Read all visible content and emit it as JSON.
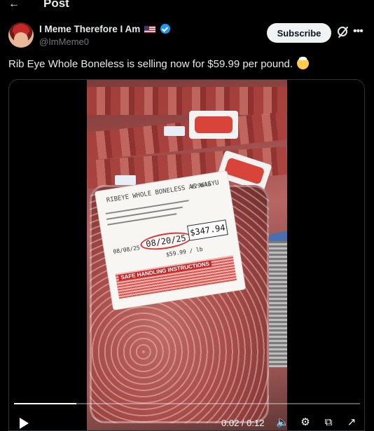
{
  "header": {
    "back_icon": "arrow-left-icon",
    "title": "Post"
  },
  "author": {
    "display_name": "I Meme Therefore I Am",
    "handle": "@ImMeme0",
    "flag_icon": "us-flag-icon",
    "verified_icon": "verified-badge-icon",
    "verified_color": "#1d9bf0"
  },
  "actions": {
    "subscribe_label": "Subscribe",
    "grok_icon": "grok-icon",
    "more_icon": "more-horizontal-icon"
  },
  "post": {
    "text": "Rib Eye Whole Boneless is selling now for $59.99 per pound.",
    "emoji": "exploding-head-emoji"
  },
  "video": {
    "label": {
      "product": "RIBEYE WHOLE BONELESS AS WAGYU",
      "plu": "#29643",
      "sell_by": "08/20/25",
      "pack_date": "08/08/25",
      "unit_price": "$59.99 / lb",
      "total_price": "$347.94",
      "safe_handling": "SAFE HANDLING INSTRUCTIONS"
    },
    "progress_fraction": 0.18,
    "current_time": "0:02",
    "separator": "/",
    "duration": "0:12",
    "time_text": "0:02 / 0:12",
    "controls": [
      "play-icon",
      "volume-icon",
      "settings-gear-icon",
      "picture-in-picture-icon",
      "fullscreen-icon"
    ]
  },
  "colors": {
    "background": "#000000",
    "text_primary": "#e7e9ea",
    "text_secondary": "#71767b",
    "subscribe_bg": "#eff3f4",
    "accent": "#1d9bf0"
  }
}
